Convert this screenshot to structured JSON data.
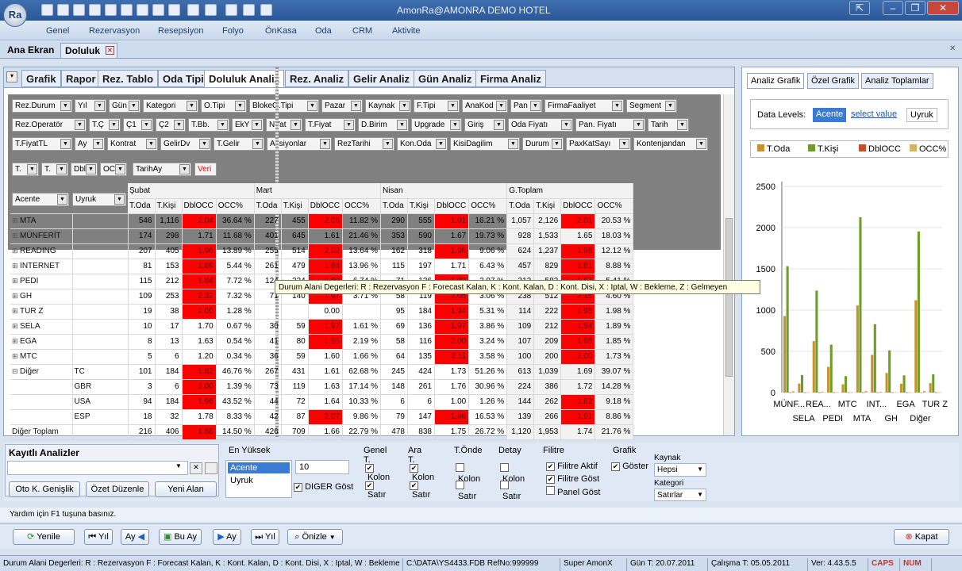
{
  "window": {
    "title": "AmonRa@AMONRA DEMO HOTEL",
    "logo": "Ra"
  },
  "menu": [
    "Genel",
    "Rezervasyon",
    "Resepsiyon",
    "Folyo",
    "ÖnKasa",
    "Oda",
    "CRM",
    "Aktivite"
  ],
  "doc_tabs": [
    "Ana Ekran",
    "Doluluk"
  ],
  "analysis_tabs": [
    "Grafik",
    "Rapor",
    "Rez. Tablo",
    "Oda Tipi",
    "Doluluk Analiz",
    "Rez. Analiz",
    "Gelir Analiz",
    "Gün Analiz",
    "Firma Analiz"
  ],
  "filter_rows": [
    [
      "Rez.Durum",
      "Yıl",
      "Gün",
      "Kategori",
      "O.Tipi",
      "BlokeO.Tipi",
      "Pazar",
      "Kaynak",
      "F.Tipi",
      "AnaKod",
      "Pan",
      "FirmaFaaliyet",
      "Segment",
      "RezUlke"
    ],
    [
      "Rez.Operatör",
      "T.Ç",
      "Ç1",
      "Ç2",
      "T.Bb.",
      "EkY",
      "NYat",
      "T.Fiyat",
      "D.Birim",
      "Upgrade",
      "Giriş",
      "Oda Fiyatı",
      "Pan. Fiyatı",
      "Tarih",
      "ÖdemeTürü"
    ],
    [
      "T.FiyatTL",
      "Ay",
      "Kontrat",
      "GelirDv",
      "T.Gelir",
      "Aksiyonlar",
      "RezTarihi",
      "Kon.Oda",
      "KisiDagilim",
      "Durum",
      "PaxKatSayı",
      "Kontenjandan"
    ]
  ],
  "data_chips": [
    "T.",
    "T.",
    "Dbl",
    "OC"
  ],
  "column_chip": "TarihAy",
  "veri_label": "Veri",
  "row_field_chips": [
    "Acente",
    "Uyruk"
  ],
  "months": [
    "Şubat",
    "Mart",
    "Nisan",
    "G.Toplam"
  ],
  "measures": [
    "T.Oda",
    "T.Kişi",
    "DblOCC",
    "OCC%"
  ],
  "rows": [
    {
      "label": "MTA",
      "sub": "",
      "v": [
        [
          "546",
          "1,116",
          "2.04",
          "36.64 %",
          1
        ],
        [
          "227",
          "455",
          "2.06",
          "11.82 %",
          1
        ],
        [
          "290",
          "555",
          "1.91",
          "16.21 %",
          1
        ],
        [
          "1,057",
          "2,126",
          "2.01",
          "20.53 %",
          1
        ]
      ]
    },
    {
      "label": "MÜNFERİT",
      "sub": "",
      "v": [
        [
          "174",
          "298",
          "1.71",
          "11.68 %",
          0
        ],
        [
          "401",
          "645",
          "1.61",
          "21.46 %",
          0
        ],
        [
          "353",
          "590",
          "1.67",
          "19.73 %",
          0
        ],
        [
          "928",
          "1,533",
          "1.65",
          "18.03 %",
          0
        ]
      ]
    },
    {
      "label": "READING",
      "sub": "",
      "v": [
        [
          "207",
          "405",
          "1.96",
          "13.89 %",
          1
        ],
        [
          "255",
          "514",
          "2.02",
          "13.64 %",
          1
        ],
        [
          "162",
          "318",
          "1.96",
          "9.06 %",
          1
        ],
        [
          "624",
          "1,237",
          "1.98",
          "12.12 %",
          1
        ]
      ]
    },
    {
      "label": "INTERNET",
      "sub": "",
      "v": [
        [
          "81",
          "153",
          "1.89",
          "5.44 %",
          1
        ],
        [
          "261",
          "479",
          "1.84",
          "13.96 %",
          1
        ],
        [
          "115",
          "197",
          "1.71",
          "6.43 %",
          0
        ],
        [
          "457",
          "829",
          "1.81",
          "8.88 %",
          1
        ]
      ]
    },
    {
      "label": "PEDI",
      "sub": "",
      "v": [
        [
          "115",
          "212",
          "1.84",
          "7.72 %",
          1
        ],
        [
          "124",
          "234",
          "1.89",
          "6.74 %",
          1
        ],
        [
          "71",
          "136",
          "1.92",
          "3.97 %",
          1
        ],
        [
          "312",
          "582",
          "1.87",
          "5.41 %",
          1
        ]
      ]
    },
    {
      "label": "GH",
      "sub": "",
      "v": [
        [
          "109",
          "253",
          "2.32",
          "7.32 %",
          1
        ],
        [
          "71",
          "140",
          "1.97",
          "3.71 %",
          1
        ],
        [
          "58",
          "119",
          "2.05",
          "3.06 %",
          1
        ],
        [
          "238",
          "512",
          "2.15",
          "4.60 %",
          1
        ]
      ]
    },
    {
      "label": "TUR Z",
      "sub": "",
      "v": [
        [
          "19",
          "38",
          "2.00",
          "1.28 %",
          1
        ],
        [
          "",
          "",
          "0.00",
          "",
          0
        ],
        [
          "95",
          "184",
          "1.94",
          "5.31 %",
          1
        ],
        [
          "114",
          "222",
          "1.95",
          "1.98 %",
          1
        ]
      ]
    },
    {
      "label": "SELA",
      "sub": "",
      "v": [
        [
          "10",
          "17",
          "1.70",
          "0.67 %",
          0
        ],
        [
          "30",
          "59",
          "1.97",
          "1.61 %",
          1
        ],
        [
          "69",
          "136",
          "1.97",
          "3.86 %",
          1
        ],
        [
          "109",
          "212",
          "1.94",
          "1.89 %",
          1
        ]
      ]
    },
    {
      "label": "EGA",
      "sub": "",
      "v": [
        [
          "8",
          "13",
          "1.63",
          "0.54 %",
          0
        ],
        [
          "41",
          "80",
          "1.95",
          "2.19 %",
          1
        ],
        [
          "58",
          "116",
          "2.00",
          "3.24 %",
          1
        ],
        [
          "107",
          "209",
          "1.95",
          "1.85 %",
          1
        ]
      ]
    },
    {
      "label": "MTC",
      "sub": "",
      "v": [
        [
          "5",
          "6",
          "1.20",
          "0.34 %",
          0
        ],
        [
          "36",
          "59",
          "1.60",
          "1.66 %",
          0
        ],
        [
          "64",
          "135",
          "2.11",
          "3.58 %",
          1
        ],
        [
          "100",
          "200",
          "2.00",
          "1.73 %",
          1
        ]
      ]
    },
    {
      "label": "Diğer",
      "sub": "TC",
      "v": [
        [
          "101",
          "184",
          "1.82",
          "46.76 %",
          1
        ],
        [
          "267",
          "431",
          "1.61",
          "62.68 %",
          0
        ],
        [
          "245",
          "424",
          "1.73",
          "51.26 %",
          0
        ],
        [
          "613",
          "1,039",
          "1.69",
          "39.07 %",
          0
        ]
      ]
    },
    {
      "label": "",
      "sub": "GBR",
      "v": [
        [
          "3",
          "6",
          "2.00",
          "1.39 %",
          1
        ],
        [
          "73",
          "119",
          "1.63",
          "17.14 %",
          0
        ],
        [
          "148",
          "261",
          "1.76",
          "30.96 %",
          0
        ],
        [
          "224",
          "386",
          "1.72",
          "14.28 %",
          0
        ]
      ]
    },
    {
      "label": "",
      "sub": "USA",
      "v": [
        [
          "94",
          "184",
          "1.96",
          "43.52 %",
          1
        ],
        [
          "44",
          "72",
          "1.64",
          "10.33 %",
          0
        ],
        [
          "6",
          "6",
          "1.00",
          "1.26 %",
          0
        ],
        [
          "144",
          "262",
          "1.82",
          "9.18 %",
          1
        ]
      ]
    },
    {
      "label": "",
      "sub": "ESP",
      "v": [
        [
          "18",
          "32",
          "1.78",
          "8.33 %",
          0
        ],
        [
          "42",
          "87",
          "2.07",
          "9.86 %",
          1
        ],
        [
          "79",
          "147",
          "1.86",
          "16.53 %",
          1
        ],
        [
          "139",
          "266",
          "1.91",
          "8.86 %",
          1
        ]
      ]
    },
    {
      "label": "Diğer Toplam",
      "sub": "",
      "v": [
        [
          "216",
          "406",
          "1.88",
          "14.50 %",
          1
        ],
        [
          "426",
          "709",
          "1.66",
          "22.79 %",
          0
        ],
        [
          "478",
          "838",
          "1.75",
          "26.72 %",
          0
        ],
        [
          "1,120",
          "1,953",
          "1.74",
          "21.76 %",
          0
        ]
      ]
    }
  ],
  "tooltip": "Durum Alani Degerleri: R : Rezervasyon F : Forecast Kalan, K : Kont. Kalan, D : Kont. Disi, X : Iptal, W : Bekleme, Z : Gelmeyen",
  "right_tabs": [
    "Analiz Grafik",
    "Özel Grafik",
    "Analiz Toplamlar"
  ],
  "data_levels_label": "Data Levels:",
  "data_levels": [
    "Acente",
    "select value",
    "Uyruk"
  ],
  "chart_data": {
    "type": "bar",
    "categories": [
      "MÜNFERİT",
      "SELA",
      "READING",
      "PEDI",
      "MTC",
      "MTA",
      "INTERNET",
      "GH",
      "EGA",
      "Diğer",
      "TUR Z"
    ],
    "category_labels_row1": [
      "MÜNF...",
      "REA...",
      "MTC",
      "INT...",
      "EGA",
      "TUR Z"
    ],
    "category_labels_row2": [
      "SELA",
      "PEDI",
      "MTA",
      "GH",
      "Diğer"
    ],
    "series": [
      {
        "name": "T.Oda",
        "color": "#c8922a",
        "values": [
          928,
          109,
          624,
          312,
          100,
          1057,
          457,
          238,
          107,
          1120,
          114
        ]
      },
      {
        "name": "T.Kişi",
        "color": "#6e9e27",
        "values": [
          1533,
          212,
          1237,
          582,
          200,
          2126,
          829,
          512,
          209,
          1953,
          222
        ]
      },
      {
        "name": "DblOCC",
        "color": "#c5502b",
        "values": [
          1.65,
          1.94,
          1.98,
          1.87,
          2.0,
          2.01,
          1.81,
          2.15,
          1.95,
          1.74,
          1.95
        ]
      },
      {
        "name": "OCC%",
        "color": "#d4b45c",
        "values": [
          18.03,
          1.89,
          12.12,
          5.41,
          1.73,
          20.53,
          8.88,
          4.6,
          1.85,
          21.76,
          1.98
        ]
      }
    ],
    "ylim": [
      0,
      2500
    ],
    "yticks": [
      "0",
      "500",
      "1000",
      "1500",
      "2000",
      "2500"
    ]
  },
  "bottom": {
    "saved_title": "Kayıtlı Analizler",
    "buttons": [
      "Oto K. Genişlik",
      "Özet Düzenle",
      "Yeni Alan"
    ],
    "en_yuksek_title": "En Yüksek",
    "en_yuksek_items": [
      "Acente",
      "Uyruk"
    ],
    "en_yuksek_value": "10",
    "diger_label": "DIGER Göst",
    "groups": [
      {
        "title": "Genel T.",
        "items": [
          "Kolon",
          "Satır"
        ],
        "checked": [
          true,
          true
        ]
      },
      {
        "title": "Ara T.",
        "items": [
          "Kolon",
          "Satır"
        ],
        "checked": [
          true,
          true
        ]
      },
      {
        "title": "T.Önde",
        "items": [
          "Kolon",
          "Satır"
        ],
        "checked": [
          false,
          false
        ]
      },
      {
        "title": "Detay",
        "items": [
          "Kolon",
          "Satır"
        ],
        "checked": [
          false,
          false
        ]
      }
    ],
    "filtre_title": "Filitre",
    "filtre_items": [
      "Filitre Aktif",
      "Filitre Göst",
      "Panel Göst"
    ],
    "grafik_title": "Grafik",
    "grafik_item": "Göster",
    "kaynak_label": "Kaynak",
    "kaynak_value": "Hepsi",
    "kategori_label": "Kategori",
    "kategori_value": "Satırlar"
  },
  "help_text": "Yardım için F1 tuşuna basınız.",
  "toolbar": [
    "Yenile",
    "Yıl",
    "Ay",
    "Bu Ay",
    "Ay",
    "Yıl",
    "Önizle"
  ],
  "close_label": "Kapat",
  "status": [
    "Durum Alani Degerleri: R : Rezervasyon F : Forecast Kalan, K : Kont. Kalan, D : Kont. Disi, X : Iptal, W : Bekleme",
    "C:\\DATA\\YS4433.FDB RefNo:999999",
    "Super AmonX",
    "Gün T: 20.07.2011",
    "Çalışma T: 05.05.2011",
    "Ver: 4.43.5.5",
    "CAPS",
    "NUM"
  ]
}
